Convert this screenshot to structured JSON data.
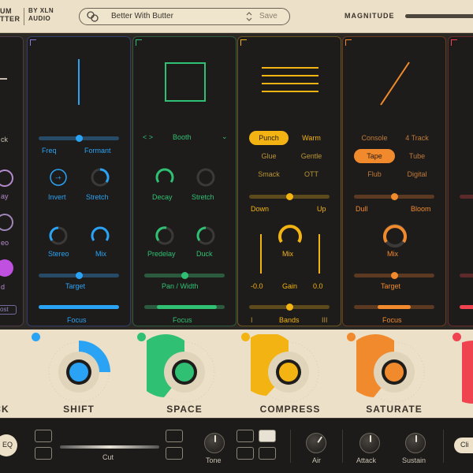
{
  "header": {
    "brand_left": [
      "UM",
      "TTER"
    ],
    "brand_right": [
      "BY XLN",
      "AUDIO"
    ],
    "preset_name": "Better With Butter",
    "save_label": "Save",
    "magnitude_label": "MAGNITUDE",
    "magnitude_value": 1.0
  },
  "colors": {
    "shift": "#2aa3f5",
    "space": "#2fc074",
    "compress": "#f3b312",
    "saturate": "#f08a2c",
    "fifth": "#ef4450",
    "cream": "#ece1c8"
  },
  "panel_first": {
    "texts": [
      "ck",
      "ay",
      "eo",
      "d"
    ],
    "button": "ost"
  },
  "panel_shift": {
    "freq": "Freq",
    "formant": "Formant",
    "invert": "Invert",
    "stretch": "Stretch",
    "stereo": "Stereo",
    "mix": "Mix",
    "target": "Target",
    "focus": "Focus"
  },
  "panel_space": {
    "room": "Booth",
    "decay": "Decay",
    "stretch": "Stretch",
    "predelay": "Predelay",
    "duck": "Duck",
    "pan_width": "Pan / Width",
    "focus": "Focus"
  },
  "panel_compress": {
    "modes": [
      "Punch",
      "Warm",
      "Glue",
      "Gentle",
      "Smack",
      "OTT"
    ],
    "down": "Down",
    "up": "Up",
    "mix": "Mix",
    "gain_left": "-0.0",
    "gain": "Gain",
    "gain_right": "0.0",
    "bands": "Bands",
    "bands_left": "I",
    "bands_right": "III"
  },
  "panel_saturate": {
    "modes": [
      "Console",
      "4 Track",
      "Tape",
      "Tube",
      "Flub",
      "Digital"
    ],
    "dull": "Dull",
    "bloom": "Bloom",
    "mix": "Mix",
    "target": "Target",
    "focus": "Focus"
  },
  "macros": {
    "first": "CK",
    "shift": "SHIFT",
    "space": "SPACE",
    "compress": "COMPRESS",
    "saturate": "SATURATE"
  },
  "bottom": {
    "eq": "EQ",
    "cut": "Cut",
    "tone": "Tone",
    "air": "Air",
    "attack": "Attack",
    "sustain": "Sustain",
    "clip": "Cli"
  }
}
